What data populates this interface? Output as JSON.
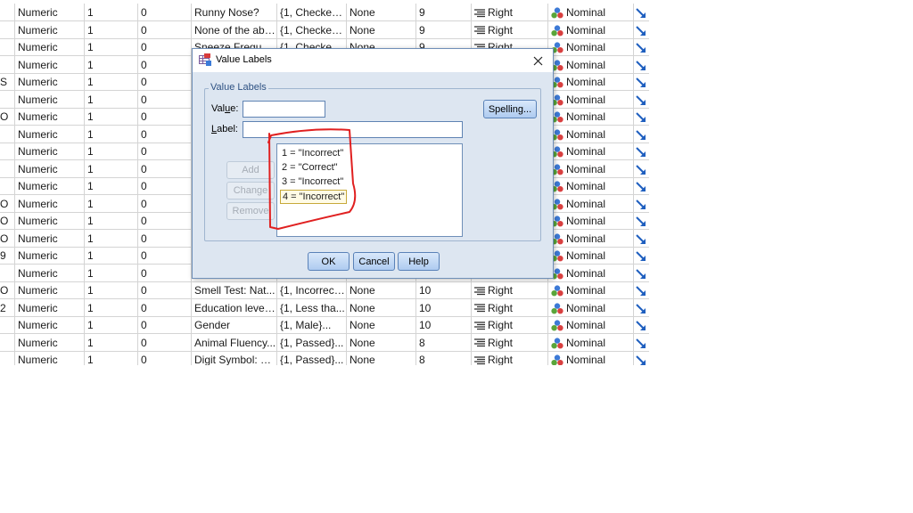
{
  "grid": {
    "rows": [
      {
        "n": "",
        "type": "Numeric",
        "width": "1",
        "decimals": "0",
        "label": "Runny Nose?",
        "values": "{1, Checked...",
        "missing": "None",
        "columns": "9",
        "align": "Right",
        "measure": "Nominal"
      },
      {
        "n": "",
        "type": "Numeric",
        "width": "1",
        "decimals": "0",
        "label": "None of the abo...",
        "values": "{1, Checked...",
        "missing": "None",
        "columns": "9",
        "align": "Right",
        "measure": "Nominal"
      },
      {
        "n": "",
        "type": "Numeric",
        "width": "1",
        "decimals": "0",
        "label": "Sneeze Freque...",
        "values": "{1, Checked...",
        "missing": "None",
        "columns": "9",
        "align": "Right",
        "measure": "Nominal"
      },
      {
        "n": "",
        "type": "Numeric",
        "width": "1",
        "decimals": "0",
        "label": "",
        "values": "",
        "missing": "",
        "columns": "",
        "align": "",
        "measure": "Nominal"
      },
      {
        "n": "S",
        "type": "Numeric",
        "width": "1",
        "decimals": "0",
        "label": "",
        "values": "",
        "missing": "",
        "columns": "",
        "align": "",
        "measure": "Nominal"
      },
      {
        "n": "",
        "type": "Numeric",
        "width": "1",
        "decimals": "0",
        "label": "",
        "values": "",
        "missing": "",
        "columns": "",
        "align": "",
        "measure": "Nominal"
      },
      {
        "n": "O",
        "type": "Numeric",
        "width": "1",
        "decimals": "0",
        "label": "",
        "values": "",
        "missing": "",
        "columns": "",
        "align": "",
        "measure": "Nominal"
      },
      {
        "n": "",
        "type": "Numeric",
        "width": "1",
        "decimals": "0",
        "label": "",
        "values": "",
        "missing": "",
        "columns": "",
        "align": "",
        "measure": "Nominal"
      },
      {
        "n": "",
        "type": "Numeric",
        "width": "1",
        "decimals": "0",
        "label": "",
        "values": "",
        "missing": "",
        "columns": "",
        "align": "",
        "measure": "Nominal"
      },
      {
        "n": "",
        "type": "Numeric",
        "width": "1",
        "decimals": "0",
        "label": "",
        "values": "",
        "missing": "",
        "columns": "",
        "align": "",
        "measure": "Nominal"
      },
      {
        "n": "",
        "type": "Numeric",
        "width": "1",
        "decimals": "0",
        "label": "",
        "values": "",
        "missing": "",
        "columns": "",
        "align": "",
        "measure": "Nominal"
      },
      {
        "n": "O",
        "type": "Numeric",
        "width": "1",
        "decimals": "0",
        "label": "",
        "values": "",
        "missing": "",
        "columns": "",
        "align": "",
        "measure": "Nominal"
      },
      {
        "n": "O",
        "type": "Numeric",
        "width": "1",
        "decimals": "0",
        "label": "",
        "values": "",
        "missing": "",
        "columns": "",
        "align": "",
        "measure": "Nominal"
      },
      {
        "n": "O",
        "type": "Numeric",
        "width": "1",
        "decimals": "0",
        "label": "",
        "values": "",
        "missing": "",
        "columns": "",
        "align": "",
        "measure": "Nominal"
      },
      {
        "n": "9",
        "type": "Numeric",
        "width": "1",
        "decimals": "0",
        "label": "",
        "values": "",
        "missing": "",
        "columns": "",
        "align": "",
        "measure": "Nominal"
      },
      {
        "n": "",
        "type": "Numeric",
        "width": "1",
        "decimals": "0",
        "label": "",
        "values": "",
        "missing": "",
        "columns": "",
        "align": "",
        "measure": "Nominal"
      },
      {
        "n": "O",
        "type": "Numeric",
        "width": "1",
        "decimals": "0",
        "label": "Smell Test: Nat...",
        "values": "{1, Incorrect...",
        "missing": "None",
        "columns": "10",
        "align": "Right",
        "measure": "Nominal"
      },
      {
        "n": "2",
        "type": "Numeric",
        "width": "1",
        "decimals": "0",
        "label": "Education level ...",
        "values": "{1, Less tha...",
        "missing": "None",
        "columns": "10",
        "align": "Right",
        "measure": "Nominal"
      },
      {
        "n": "",
        "type": "Numeric",
        "width": "1",
        "decimals": "0",
        "label": "Gender",
        "values": "{1, Male}...",
        "missing": "None",
        "columns": "10",
        "align": "Right",
        "measure": "Nominal"
      },
      {
        "n": "",
        "type": "Numeric",
        "width": "1",
        "decimals": "0",
        "label": "Animal Fluency...",
        "values": "{1, Passed}...",
        "missing": "None",
        "columns": "8",
        "align": "Right",
        "measure": "Nominal"
      },
      {
        "n": "",
        "type": "Numeric",
        "width": "1",
        "decimals": "0",
        "label": "Digit Symbol: S...",
        "values": "{1, Passed}...",
        "missing": "None",
        "columns": "8",
        "align": "Right",
        "measure": "Nominal"
      }
    ]
  },
  "dialog": {
    "title": "Value Labels",
    "group_title": "Value Labels",
    "value_label_a": "Val",
    "value_label_u": "u",
    "value_label_b": "e:",
    "label_label_u": "L",
    "label_label_b": "abel:",
    "value_input": "",
    "label_input": "",
    "spelling": "Spelling...",
    "add": "Add",
    "change": "Change",
    "remove": "Remove",
    "list": [
      "1 = \"Incorrect\"",
      "2 = \"Correct\"",
      "3 = \"Incorrect\"",
      "4 = \"Incorrect\""
    ],
    "ok": "OK",
    "cancel": "Cancel",
    "help": "Help"
  },
  "colors": {
    "annotation": "#e02020",
    "role_arrow": "#1f5fbf"
  }
}
